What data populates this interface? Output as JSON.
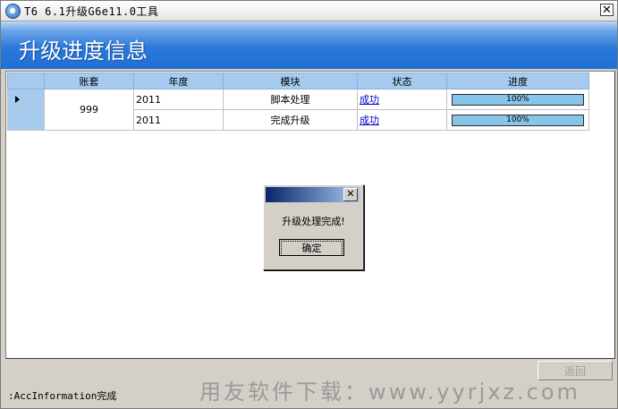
{
  "window": {
    "title": "T6 6.1升级G6e11.0工具"
  },
  "banner": {
    "title": "升级进度信息"
  },
  "grid": {
    "columns": [
      "账套",
      "年度",
      "模块",
      "状态",
      "进度"
    ],
    "account": "999",
    "rows": [
      {
        "year": "2011",
        "module": "脚本处理",
        "status": "成功",
        "progress": "100%"
      },
      {
        "year": "2011",
        "module": "完成升级",
        "status": "成功",
        "progress": "100%"
      }
    ]
  },
  "dialog": {
    "message": "升级处理完成!",
    "ok_label": "确定"
  },
  "footer": {
    "back_label": "返回",
    "status_text": ":AccInformation完成"
  },
  "watermark": "用友软件下载：www.yyrjxz.com",
  "icons": {
    "app": "app-icon",
    "close": "close-icon",
    "row_marker": "row-marker-icon"
  },
  "colors": {
    "banner": "#2b78d8",
    "grid_header": "#a6cbef",
    "progress_fill": "#87c6ea",
    "link": "#0000cc"
  }
}
